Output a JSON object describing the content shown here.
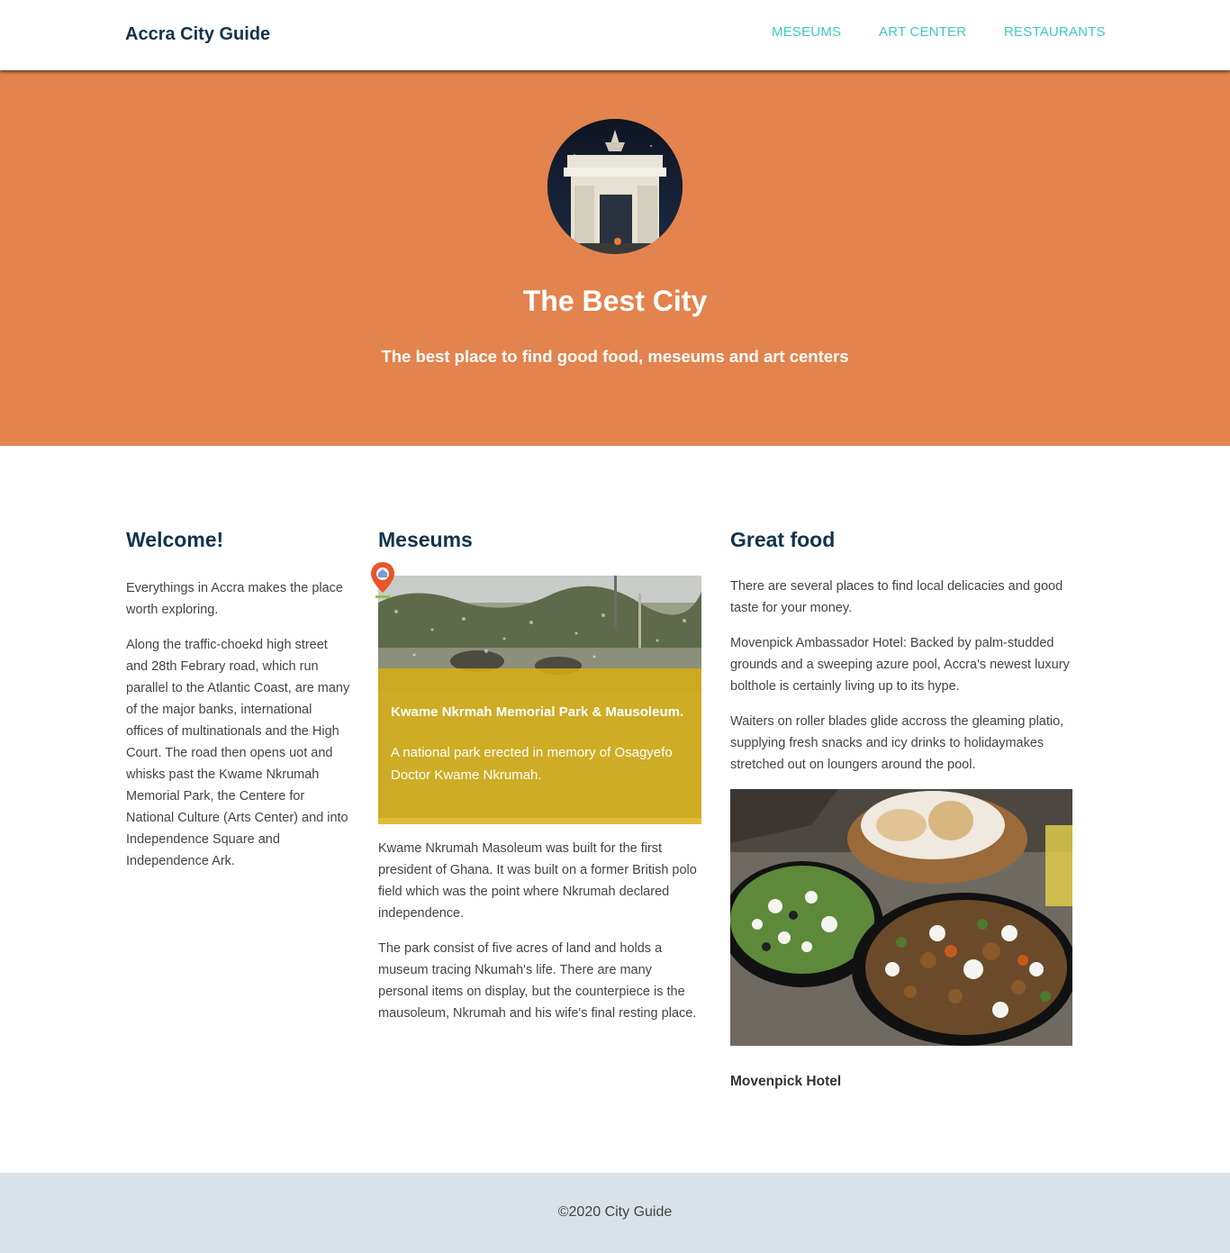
{
  "header": {
    "brand": "Accra City Guide",
    "nav": [
      "MESEUMS",
      "ART CENTER",
      "RESTAURANTS"
    ]
  },
  "hero": {
    "image_alt": "Independence Arch at night",
    "title": "The Best City",
    "subtitle": "The best place to find good food, meseums and art centers"
  },
  "welcome": {
    "title": "Welcome!",
    "paragraphs": [
      "Everythings in Accra makes the place worth exploring.",
      "Along the traffic-choekd high street and 28th Febrary road, which run parallel to the Atlantic Coast, are many of the major banks, international offices of multinationals and the High Court. The road then opens uot and whisks past the Kwame Nkrumah Memorial Park, the Centere for National Culture (Arts Center) and into Independence Square and Independence Ark."
    ]
  },
  "museums": {
    "title": "Meseums",
    "card_title": "Kwame Nkrmah Memorial Park & Mausoleum.",
    "card_desc": "A national park erected in memory of Osagyefo Doctor Kwame Nkrumah.",
    "paragraphs": [
      "Kwame Nkrumah Masoleum was built for the first president of Ghana. It was built on a former British polo field which was the point where Nkrumah declared independence.",
      "The park consist of five acres of land and holds a museum tracing Nkumah's life. There are many personal items on display, but the counterpiece is the mausoleum, Nkrumah and his wife's final resting place."
    ]
  },
  "food": {
    "title": "Great food",
    "paragraphs": [
      "There are several places to find local delicacies and good taste for your money.",
      "Movenpick Ambassador Hotel: Backed by palm-studded grounds and a sweeping azure pool, Accra's newest luxury bolthole is certainly living up to its hype.",
      "Waiters on roller blades glide accross the gleaming platio, supplying fresh snacks and icy drinks to holidaymakes stretched out on loungers around the pool."
    ],
    "caption": "Movenpick Hotel"
  },
  "footer": {
    "text": "©2020 City Guide"
  },
  "colors": {
    "hero_bg": "#e3834d",
    "brand": "#12344d",
    "nav_link": "#3ecabd",
    "card_overlay": "#d6ae14",
    "footer_bg": "#d8e2e8"
  },
  "icons": [
    "map-pin-icon"
  ]
}
